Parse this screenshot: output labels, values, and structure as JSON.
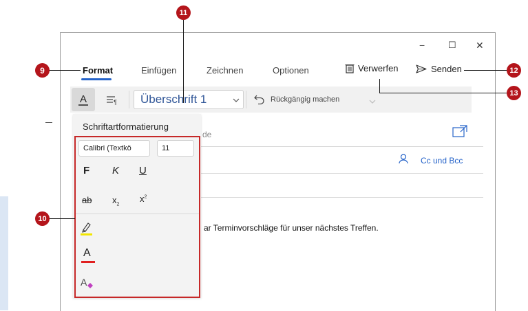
{
  "window": {
    "minimize": "−",
    "maximize": "☐",
    "close": "✕"
  },
  "tabs": [
    {
      "label": "Format",
      "active": true
    },
    {
      "label": "Einfügen",
      "active": false
    },
    {
      "label": "Zeichnen",
      "active": false
    },
    {
      "label": "Optionen",
      "active": false
    }
  ],
  "actions": {
    "discard": "Verwerfen",
    "send": "Senden"
  },
  "ribbon": {
    "style_value": "Überschrift 1",
    "undo_label": "Rückgängig machen"
  },
  "panel": {
    "title": "Schriftartformatierung",
    "font_name": "Calibri (Textkö",
    "font_size": "11",
    "bold": "F",
    "italic": "K",
    "underline": "U",
    "strike": "ab",
    "subscript": "x",
    "subscript_mark": "2",
    "superscript": "x",
    "superscript_mark": "2",
    "font_color_glyph": "A",
    "clear_glyph": "A"
  },
  "mail": {
    "to_fragment": "de",
    "cc_bcc": "Cc und Bcc",
    "body_fragment": "ar Terminvorschläge für unser nächstes Treffen."
  },
  "callouts": {
    "c9": "9",
    "c10": "10",
    "c11": "11",
    "c12": "12",
    "c13": "13"
  },
  "colors": {
    "callout": "#b4151b",
    "accent": "#2563c9",
    "highlight": "#f2e600",
    "fontcolor": "#e02020"
  }
}
